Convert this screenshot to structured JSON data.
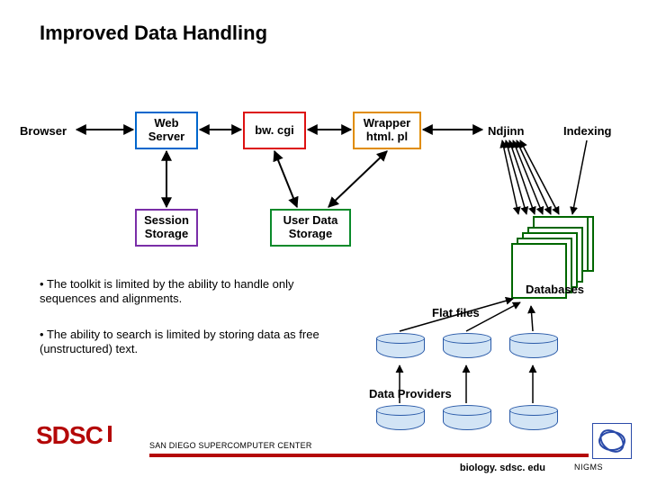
{
  "title": "Improved Data Handling",
  "nodes": {
    "browser": "Browser",
    "web_server": "Web\nServer",
    "bw_cgi": "bw. cgi",
    "wrapper": "Wrapper\nhtml. pl",
    "ndjinn": "Ndjinn",
    "indexing": "Indexing",
    "session_storage": "Session\nStorage",
    "user_data_storage": "User Data\nStorage",
    "databases": "Databases",
    "flat_files": "Flat files",
    "data_providers": "Data Providers"
  },
  "bullets": [
    "The toolkit is limited by the ability to handle only sequences and alignments.",
    "The ability to search is limited by storing data as free (unstructured) text."
  ],
  "footer": {
    "center": "SAN DIEGO SUPERCOMPUTER CENTER",
    "url": "biology. sdsc. edu",
    "nigms": "NIGMS",
    "sdsc": "SDSC"
  }
}
